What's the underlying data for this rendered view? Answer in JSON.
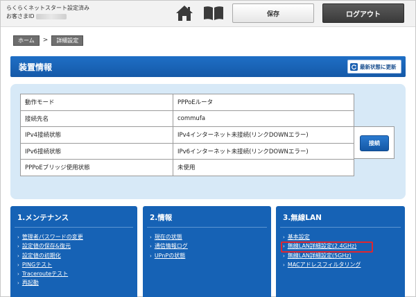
{
  "header": {
    "status_line": "らくらくネットスタート設定済み",
    "customer_label": "お客さまID",
    "save_label": "保存",
    "logout_label": "ログアウト"
  },
  "breadcrumb": [
    "ホーム",
    ">",
    "詳細設定"
  ],
  "device": {
    "title": "装置情報",
    "refresh_label": "最新状態に更新",
    "connect_label": "接続",
    "rows": [
      {
        "label": "動作モード",
        "value": "PPPoEルータ"
      },
      {
        "label": "接続先名",
        "value": "commufa"
      },
      {
        "label": "IPv4接続状態",
        "value": "IPv4インターネット未接続(リンクDOWNエラー)"
      },
      {
        "label": "IPv6接続状態",
        "value": "IPv6インターネット未接続(リンクDOWNエラー)"
      },
      {
        "label": "PPPoEブリッジ使用状態",
        "value": "未使用"
      }
    ]
  },
  "menus": [
    {
      "title": "1.メンテナンス",
      "items": [
        "管理者パスワードの変更",
        "設定値の保存&復元",
        "設定値の初期化",
        "PINGテスト",
        "Tracerouteテスト",
        "再起動"
      ]
    },
    {
      "title": "2.情報",
      "items": [
        "現在の状態",
        "通信情報ログ",
        "UPnPの状態"
      ]
    },
    {
      "title": "3.無線LAN",
      "items": [
        "基本設定",
        "無線LAN詳細設定(2.4GHz)",
        "無線LAN詳細設定(5GHz)",
        "MACアドレスフィルタリング"
      ]
    }
  ],
  "colors": {
    "accent": "#1662b5",
    "panel_bg": "#d7e9f7",
    "highlight": "#e0262f"
  }
}
